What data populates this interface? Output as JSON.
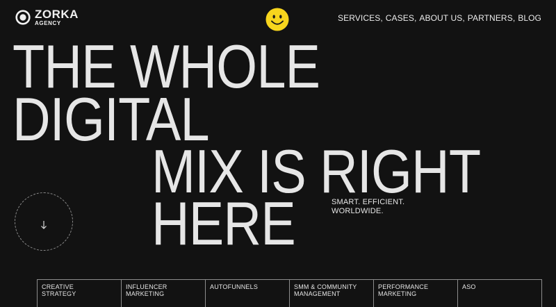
{
  "brand": {
    "name": "ZORKA",
    "sub": "AGENCY"
  },
  "nav": {
    "items": [
      "SERVICES",
      "CASES",
      "ABOUT US",
      "PARTNERS",
      "BLOG"
    ],
    "separator": ","
  },
  "hero": {
    "lines": [
      "THE WHOLE",
      "DIGITAL",
      "MIX IS RIGHT",
      "HERE"
    ],
    "tagline": [
      "SMART. EFFICIENT.",
      "WORLDWIDE."
    ]
  },
  "services": [
    {
      "lines": [
        "CREATIVE",
        "STRATEGY"
      ]
    },
    {
      "lines": [
        "INFLUENCER",
        "MARKETING"
      ]
    },
    {
      "lines": [
        "AUTOFUNNELS"
      ]
    },
    {
      "lines": [
        "SMM & COMMUNITY",
        "MANAGEMENT"
      ]
    },
    {
      "lines": [
        "PERFORMANCE",
        "MARKETING"
      ]
    },
    {
      "lines": [
        "ASO"
      ]
    }
  ],
  "icons": {
    "logo": "target-logo-icon",
    "smiley": "smiley-face-icon",
    "scroll": "arrow-down-icon"
  },
  "colors": {
    "background": "#121212",
    "text": "#e6e6e6",
    "smiley": "#f7d51d",
    "border": "#8d8d8d"
  }
}
